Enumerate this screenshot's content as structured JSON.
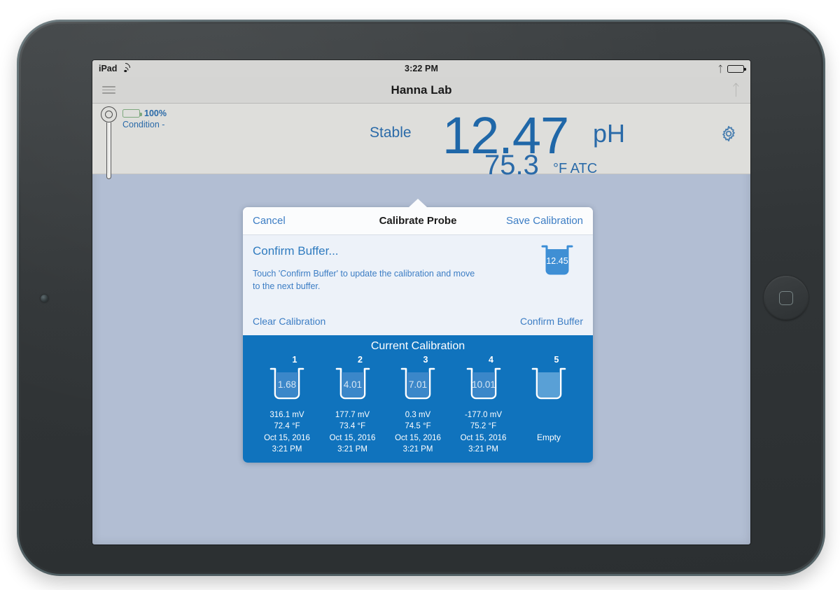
{
  "device": {
    "name": "iPad",
    "home_button_icon": "rounded-square-icon",
    "camera_icon": "front-camera-dot"
  },
  "status_bar": {
    "carrier": "iPad",
    "wifi_icon": "wifi-icon",
    "time": "3:22 PM",
    "bluetooth_icon": "bluetooth-icon",
    "battery_icon": "battery-icon"
  },
  "nav_bar": {
    "menu_icon": "hamburger-menu-icon",
    "title": "Hanna Lab",
    "bluetooth_icon": "bluetooth-icon"
  },
  "meter": {
    "probe_icon": "ph-probe-icon",
    "battery_icon": "battery-icon",
    "battery_percent": "100%",
    "condition": "Condition -",
    "stability": "Stable",
    "ph_value": "12.47",
    "ph_unit": "pH",
    "temperature": "75.3",
    "temperature_unit": "°F ATC",
    "settings_icon": "gear-icon"
  },
  "popover": {
    "cancel_label": "Cancel",
    "title": "Calibrate Probe",
    "save_label": "Save Calibration",
    "heading": "Confirm Buffer...",
    "description": "Touch 'Confirm Buffer' to update the calibration and move to the next buffer.",
    "current_beaker_value": "12.45",
    "clear_label": "Clear Calibration",
    "confirm_label": "Confirm Buffer"
  },
  "calibration": {
    "title": "Current Calibration",
    "empty_label": "Empty",
    "buffers": [
      {
        "index": "1",
        "value": "1.68",
        "mv": "316.1 mV",
        "temp": "72.4 °F",
        "date": "Oct 15, 2016",
        "time": "3:21 PM",
        "filled": true
      },
      {
        "index": "2",
        "value": "4.01",
        "mv": "177.7 mV",
        "temp": "73.4 °F",
        "date": "Oct 15, 2016",
        "time": "3:21 PM",
        "filled": true
      },
      {
        "index": "3",
        "value": "7.01",
        "mv": "0.3 mV",
        "temp": "74.5 °F",
        "date": "Oct 15, 2016",
        "time": "3:21 PM",
        "filled": true
      },
      {
        "index": "4",
        "value": "10.01",
        "mv": "-177.0 mV",
        "temp": "75.2 °F",
        "date": "Oct 15, 2016",
        "time": "3:21 PM",
        "filled": true
      },
      {
        "index": "5",
        "value": "",
        "mv": "",
        "temp": "",
        "date": "",
        "time": "",
        "filled": false
      }
    ]
  },
  "colors": {
    "accent_blue": "#3c7dc4",
    "panel_blue": "#1073bd",
    "reading_blue": "#1f67a8",
    "screen_background": "#b2bed3",
    "battery_green": "#4cc14c"
  }
}
